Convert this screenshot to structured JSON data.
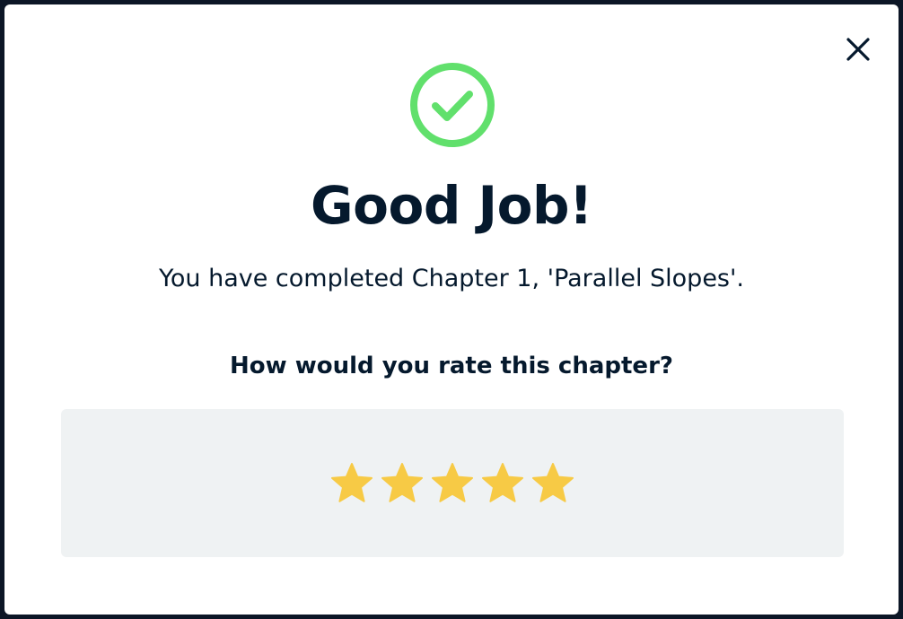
{
  "modal": {
    "title": "Good Job!",
    "subtitle": "You have completed Chapter 1, 'Parallel Slopes'.",
    "question": "How would you rate this chapter?",
    "close_icon": "close-icon",
    "success_icon": "check-circle-icon"
  },
  "rating": {
    "max": 5,
    "value": 5,
    "star_color": "#f7ca45"
  },
  "colors": {
    "success_green": "#61e06c",
    "text_dark": "#05192d",
    "panel_bg": "#eff2f3"
  }
}
